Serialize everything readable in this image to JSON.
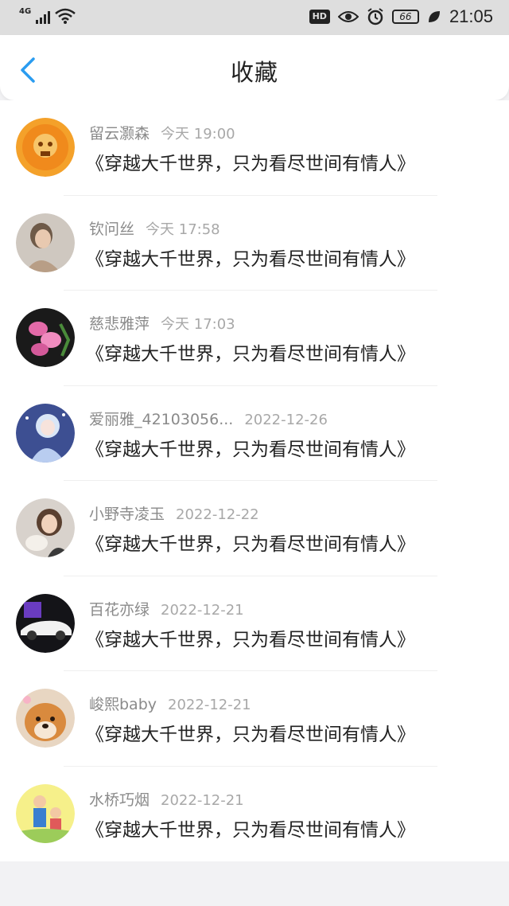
{
  "status_bar": {
    "network": "4G",
    "hd": "HD",
    "battery": "66",
    "time": "21:05"
  },
  "header": {
    "title": "收藏"
  },
  "items": [
    {
      "name": "留云灏森",
      "date": "今天 19:00",
      "title": "《穿越大千世界，只为看尽世间有情人》"
    },
    {
      "name": "钦问丝",
      "date": "今天 17:58",
      "title": "《穿越大千世界，只为看尽世间有情人》"
    },
    {
      "name": "慈悲雅萍",
      "date": "今天 17:03",
      "title": "《穿越大千世界，只为看尽世间有情人》"
    },
    {
      "name": "爱丽雅_42103056...",
      "date": "2022-12-26",
      "title": "《穿越大千世界，只为看尽世间有情人》"
    },
    {
      "name": "小野寺凌玉",
      "date": "2022-12-22",
      "title": "《穿越大千世界，只为看尽世间有情人》"
    },
    {
      "name": "百花亦绿",
      "date": "2022-12-21",
      "title": "《穿越大千世界，只为看尽世间有情人》"
    },
    {
      "name": "峻熙baby",
      "date": "2022-12-21",
      "title": "《穿越大千世界，只为看尽世间有情人》"
    },
    {
      "name": "水桥巧烟",
      "date": "2022-12-21",
      "title": "《穿越大千世界，只为看尽世间有情人》"
    }
  ],
  "colors": {
    "accent": "#2a9cf0",
    "name": "#8a8a8a",
    "date": "#a8a8a8",
    "title": "#222222"
  }
}
